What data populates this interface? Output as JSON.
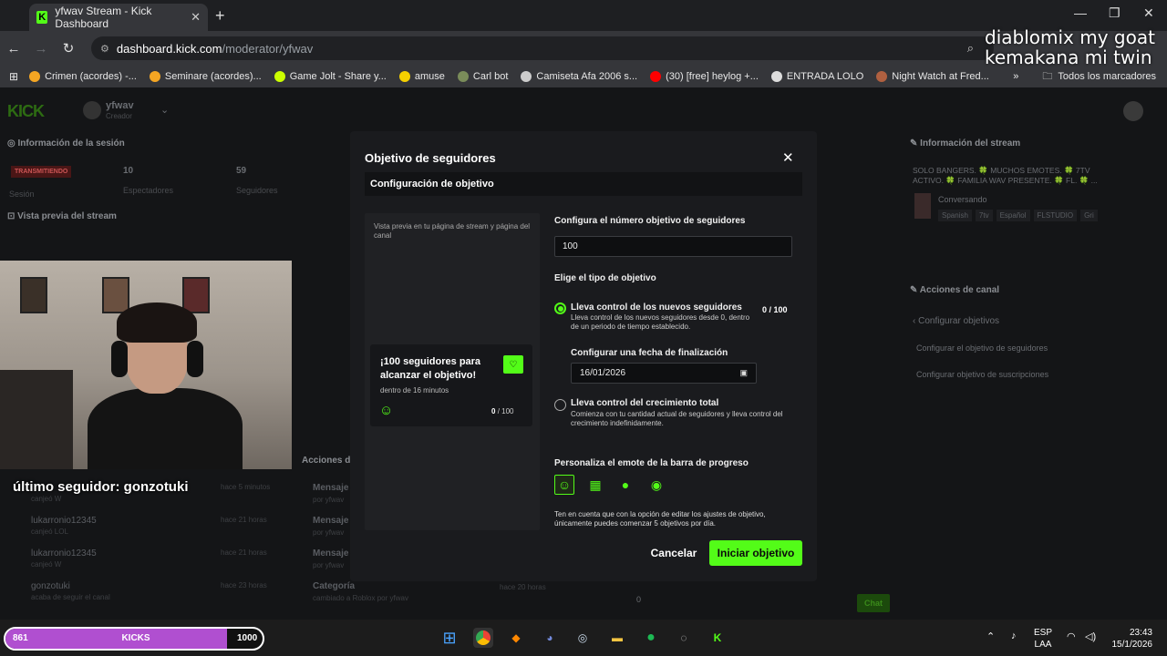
{
  "browser": {
    "tab_title": "yfwav Stream - Kick Dashboard",
    "url_host": "dashboard.kick.com",
    "url_path": "/moderator/yfwav",
    "bookmarks": [
      {
        "label": "Crimen (acordes) -...",
        "color": "#f5a623"
      },
      {
        "label": "Seminare (acordes)...",
        "color": "#f5a623"
      },
      {
        "label": "Game Jolt - Share y...",
        "color": "#ccff00"
      },
      {
        "label": "amuse",
        "color": "#f5d000"
      },
      {
        "label": "Carl bot",
        "color": "#7a8c5a"
      },
      {
        "label": "Camiseta Afa 2006 s...",
        "color": "#cccccc"
      },
      {
        "label": "(30) [free] heylog +...",
        "color": "#ff0000"
      },
      {
        "label": "ENTRADA LOLO",
        "color": "#dddddd"
      },
      {
        "label": "Night Watch at Fred...",
        "color": "#b06040"
      }
    ],
    "all_bookmarks": "Todos los marcadores"
  },
  "stream_overlay": {
    "top_text": "diablomix my goat\nkemakana mi twin",
    "last_follower": "último seguidor: gonzotuki",
    "kicks_value": "861",
    "kicks_label": "KICKS",
    "kicks_target": "1000",
    "kicks_progress": 0.861
  },
  "dashboard": {
    "channel": "yfwav",
    "role": "Creador",
    "session_title": "Información de la sesión",
    "live_badge": "TRANSMITIENDO",
    "session_label": "Sesión",
    "viewers_count": "10",
    "viewers_label": "Espectadores",
    "followers_count": "59",
    "followers_label": "Seguidores",
    "preview_title": "Vista previa del stream",
    "stream_info_title": "Información del stream",
    "stream_title": "SOLO BANGERS. 🍀 MUCHOS EMOTES. 🍀 7TV ACTIVO. 🍀 FAMILIA WAV PRESENTE. 🍀 FL. 🍀 ...",
    "category": "Conversando",
    "tags": [
      "Spanish",
      "7tv",
      "Español",
      "FLSTUDIO",
      "Gri"
    ],
    "channel_actions_title": "Acciones de canal",
    "configure_goals": "Configurar objetivos",
    "goal_followers": "Configurar el objetivo de seguidores",
    "goal_subs": "Configurar objetivo de suscripciones",
    "actions_label": "Acciones de",
    "activity": [
      {
        "user": "",
        "action": "canjeó W",
        "time": "hace 5 minutos"
      },
      {
        "user": "lukarronio12345",
        "action": "canjeó LOL",
        "time": "hace 21 horas"
      },
      {
        "user": "lukarronio12345",
        "action": "canjeó W",
        "time": "hace 21 horas"
      },
      {
        "user": "gonzotuki",
        "action": "acaba de seguir el canal",
        "time": "hace 23 horas"
      }
    ],
    "mod_actions": [
      {
        "title": "Mensaje",
        "by": "por yfwav"
      },
      {
        "title": "Mensaje",
        "by": "por yfwav"
      },
      {
        "title": "Mensaje",
        "by": "por yfwav"
      },
      {
        "title": "Categoría",
        "by": "cambiado a Roblox por yfwav",
        "time": "hace 20 horas"
      }
    ],
    "chat_button": "Chat",
    "chat_count": "0"
  },
  "modal": {
    "title": "Objetivo de seguidores",
    "section": "Configuración de objetivo",
    "preview_caption": "Vista previa en tu página de stream y página del canal",
    "card_title": "¡100 seguidores para alcanzar el objetivo!",
    "card_time": "dentro de 16 minutos",
    "card_count_current": "0",
    "card_count_total": "/ 100",
    "target_label": "Configura el número objetivo de seguidores",
    "target_value": "100",
    "type_label": "Elige el tipo de objetivo",
    "option1_title": "Lleva control de los nuevos seguidores",
    "option1_desc": "Lleva control de los nuevos seguidores desde 0, dentro de un periodo de tiempo establecido.",
    "option1_count": "0 / 100",
    "date_label": "Configurar una fecha de finalización",
    "date_value": "16/01/2026",
    "option2_title": "Lleva control del crecimiento total",
    "option2_desc": "Comienza con tu cantidad actual de seguidores y lleva control del crecimiento indefinidamente.",
    "emote_label": "Personaliza el emote de la barra de progreso",
    "note": "Ten en cuenta que con la opción de editar los ajustes de objetivo, únicamente puedes comenzar 5 objetivos por día.",
    "cancel": "Cancelar",
    "start": "Iniciar objetivo"
  },
  "taskbar": {
    "lang": "ESP",
    "layout": "LAA",
    "time": "23:43",
    "date": "15/1/2026"
  }
}
